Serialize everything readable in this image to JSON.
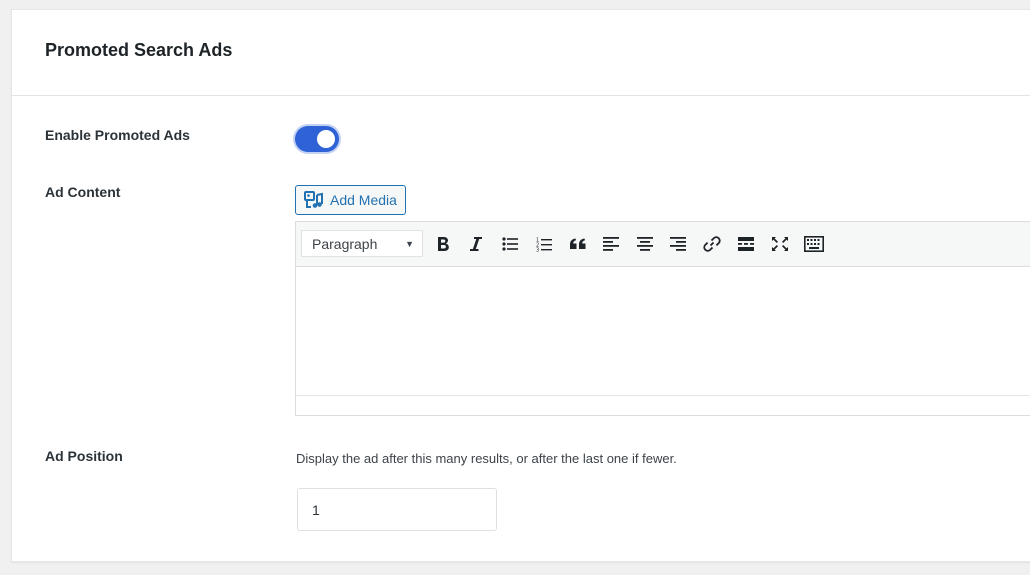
{
  "card": {
    "title": "Promoted Search Ads"
  },
  "enable": {
    "label": "Enable Promoted Ads",
    "enabled": true,
    "accent": "#2e62d6"
  },
  "content": {
    "label": "Ad Content",
    "add_media_label": "Add Media",
    "toolbar": {
      "format_value": "Paragraph",
      "buttons": [
        {
          "name": "bold-icon"
        },
        {
          "name": "italic-icon"
        },
        {
          "name": "bulleted-list-icon"
        },
        {
          "name": "numbered-list-icon"
        },
        {
          "name": "blockquote-icon"
        },
        {
          "name": "align-left-icon"
        },
        {
          "name": "align-center-icon"
        },
        {
          "name": "align-right-icon"
        },
        {
          "name": "link-icon"
        },
        {
          "name": "read-more-icon"
        },
        {
          "name": "fullscreen-icon"
        },
        {
          "name": "toolbar-toggle-icon"
        }
      ]
    }
  },
  "position": {
    "label": "Ad Position",
    "description": "Display the ad after this many results, or after the last one if fewer.",
    "value": "1"
  }
}
